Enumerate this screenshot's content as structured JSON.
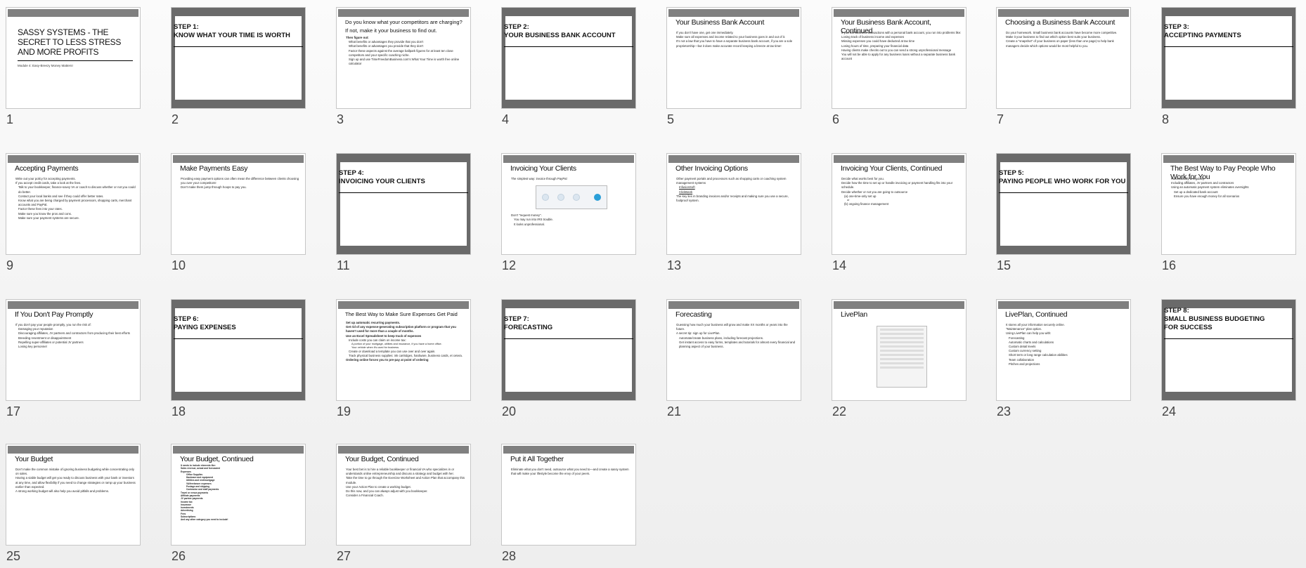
{
  "slides": [
    {
      "n": "1",
      "type": "title",
      "title": "SASSY SYSTEMS - THE SECRET TO LESS STRESS AND MORE PROFITS",
      "subtitle": "Module 4: Easy-Breezy Money Matters!"
    },
    {
      "n": "2",
      "type": "section",
      "title": "STEP 1:\nKNOW WHAT YOUR TIME IS WORTH"
    },
    {
      "n": "3",
      "type": "content",
      "title": "Do you know what your competitors are charging? If not, make it your business to find out.",
      "small": true,
      "lines": [
        {
          "t": "Then figure out:",
          "l": 0
        },
        {
          "t": "What benefits or advantages they provide that you don't",
          "l": 1
        },
        {
          "t": "What benefits or advantages you provide that they don't",
          "l": 1
        },
        {
          "t": "Factor these aspects against the average ballpark figures for at least ten close competitors and your specific coaching niche.",
          "l": 1
        },
        {
          "t": "Sign up and use TimeFreedomBusiness.com's What Your Time is worth free online calculator",
          "l": 1
        }
      ]
    },
    {
      "n": "4",
      "type": "section",
      "title": "STEP 2:\nYOUR BUSINESS BANK ACCOUNT"
    },
    {
      "n": "5",
      "type": "content",
      "title": "Your Business Bank Account",
      "lines": [
        {
          "t": "If you don't have one, get one immediately.",
          "l": 0
        },
        {
          "t": "Make sure all expenses and income related to your business goes in and out of it.",
          "l": 0
        },
        {
          "t": "It's not a law that you have to have a separate business bank account, if you are a sole proprietorship—but it does make accurate record keeping a breeze at tax time!",
          "l": 0
        }
      ]
    },
    {
      "n": "6",
      "type": "content",
      "title": "Your Business Bank Account, Continued",
      "lines": [
        {
          "t": "If you mix business transactions with a personal bank account, you run into problems like:",
          "l": 0
        },
        {
          "t": "Losing track of business income and expenses",
          "l": 0
        },
        {
          "t": "Missing expenses you could have deducted at tax time",
          "l": 0
        },
        {
          "t": "Losing hours of time, preparing your financial data",
          "l": 0
        },
        {
          "t": "Having clients make checks out to you can send a strong unprofessional message",
          "l": 0
        },
        {
          "t": "You will not be able to apply for any business loans without a separate business bank account",
          "l": 0
        }
      ]
    },
    {
      "n": "7",
      "type": "content",
      "title": "Choosing a Business Bank Account",
      "lines": [
        {
          "t": "Do your homework. Small business bank accounts have become more competitive.",
          "l": 0
        },
        {
          "t": "Make it your business to find out which option best suits your business.",
          "l": 0
        },
        {
          "t": "Create a \"snapshot\" of your business on paper (less than one page) to help bank managers decide which options would be most helpful to you.",
          "l": 0
        }
      ]
    },
    {
      "n": "8",
      "type": "section",
      "title": "STEP 3:\nACCEPTING PAYMENTS"
    },
    {
      "n": "9",
      "type": "content",
      "title": "Accepting Payments",
      "lines": [
        {
          "t": "Write out your policy for accepting payments.",
          "l": 0
        },
        {
          "t": "If you accept credit cards, take a look at the fees.",
          "l": 0
        },
        {
          "t": "Talk to your bookkeeper, finance-savvy VA or coach to discuss whether or not you could do better.",
          "l": 1
        },
        {
          "t": "Contact your local banks and see if they could offer better rates.",
          "l": 1
        },
        {
          "t": "Know what you are being charged by payment processors, shopping carts, merchant accounts and PayPal.",
          "l": 1
        },
        {
          "t": "Factor these fees into your rates.",
          "l": 1
        },
        {
          "t": "Make sure you know the pros and cons.",
          "l": 1
        },
        {
          "t": "Make sure your payment systems are secure.",
          "l": 1
        }
      ]
    },
    {
      "n": "10",
      "type": "content",
      "title": "Make Payments Easy",
      "lines": [
        {
          "t": "Providing easy payment options can often mean the difference between clients choosing you over your competitors!",
          "l": 0,
          "nb": true
        },
        {
          "t": " ",
          "l": 0,
          "nb": true
        },
        {
          "t": "Don't make them jump through hoops to pay you.",
          "l": 0,
          "nb": true
        }
      ]
    },
    {
      "n": "11",
      "type": "section",
      "title": "STEP 4:\nINVOICING YOUR CLIENTS"
    },
    {
      "n": "12",
      "type": "content",
      "title": "Invoicing Your Clients",
      "image": "paypal-screenshot",
      "lines": [
        {
          "t": "The simplest way: invoice through PayPal",
          "l": 0
        },
        {
          "img": true
        },
        {
          "t": "Don't \"request money\".",
          "l": 0
        },
        {
          "t": "You may run into IRS trouble.",
          "l": 1
        },
        {
          "t": "It looks unprofessional.",
          "l": 1
        }
      ]
    },
    {
      "n": "13",
      "type": "content",
      "title": "Other Invoicing Options",
      "lines": [
        {
          "t": "Other payment portals and processors such as shopping carts or coaching system management systems",
          "l": 0
        },
        {
          "t": "InfusionSoft",
          "l": 1,
          "u": true
        },
        {
          "t": "ClickBank",
          "l": 1,
          "u": true
        },
        {
          "t": " ",
          "l": 0,
          "nb": true
        },
        {
          "t": "The key lies in branding invoices and/or receipts and making sure you use a secure, foolproof system.",
          "l": 0
        }
      ]
    },
    {
      "n": "14",
      "type": "content",
      "title": "Invoicing Your Clients, Continued",
      "lines": [
        {
          "t": "Decide what works best for you.",
          "l": 0
        },
        {
          "t": "Decide how the time to set up or handle invoicing or payment handling fits into your schedule.",
          "l": 0
        },
        {
          "t": "Decide whether or not you are going to outsource",
          "l": 0
        },
        {
          "t": "(a) one-time-only set up",
          "l": 1
        },
        {
          "t": "or",
          "l": 2,
          "nb": true
        },
        {
          "t": "(b) ongoing finance management",
          "l": 1
        }
      ]
    },
    {
      "n": "15",
      "type": "section",
      "title": "STEP 5:\nPAYING PEOPLE WHO WORK FOR YOU"
    },
    {
      "n": "16",
      "type": "content",
      "title": "The Best Way to Pay People Who Work for You",
      "lines": [
        {
          "t": "Automatically & regularly",
          "l": 0
        },
        {
          "t": "Including affiliates, JV partners and contractors",
          "l": 0
        },
        {
          "t": "Using an automatic payment system eliminates oversights",
          "l": 0
        },
        {
          "t": "Set up a dedicated bank account",
          "l": 1
        },
        {
          "t": "Ensure you have enough money for all scenarios",
          "l": 1
        }
      ]
    },
    {
      "n": "17",
      "type": "content",
      "title": "If You Don't Pay Promptly",
      "lines": [
        {
          "t": "If you don't pay your people promptly, you run the risk of:",
          "l": 0
        },
        {
          "t": "Damaging your reputation",
          "l": 1
        },
        {
          "t": "Discouraging affiliates, JV partners and contractors from producing their best efforts",
          "l": 1
        },
        {
          "t": "Breeding resentment or disappointment",
          "l": 1
        },
        {
          "t": "Repelling super-affiliates or potential JV partners",
          "l": 1
        },
        {
          "t": "Losing key personnel",
          "l": 1
        }
      ]
    },
    {
      "n": "18",
      "type": "section",
      "title": "STEP 6:\nPAYING EXPENSES"
    },
    {
      "n": "19",
      "type": "content",
      "title": "The Best Way to Make Sure Expenses Get Paid",
      "small": true,
      "lines": [
        {
          "t": "Set up automatic recurring payments.",
          "l": 0
        },
        {
          "t": "Get rid of any expense-generating subscription platform or program that you haven't used for more than a couple of months.",
          "l": 0
        },
        {
          "t": "Use an Excel Spreadsheet to keep track of expenses",
          "l": 0
        },
        {
          "t": "Include costs you can claim on income tax:",
          "l": 1
        },
        {
          "t": "A portion of your mortgage, utilities and insurance, if you have a home office.",
          "l": 2
        },
        {
          "t": "Your vehicle when it's used for business.",
          "l": 2
        },
        {
          "t": "Create or download a template you can use over and over again.",
          "l": 1
        },
        {
          "t": "Track physical business supplies: ink cartridges, hardware, business cards, et cetera.",
          "l": 1
        },
        {
          "t": "Ordering online forces you to pre-pay at point of ordering",
          "l": 0
        }
      ]
    },
    {
      "n": "20",
      "type": "section",
      "title": "STEP 7:\nFORECASTING"
    },
    {
      "n": "21",
      "type": "content",
      "title": "Forecasting",
      "lines": [
        {
          "t": "Guessing how much your business will grow and make XX months or years into the future.",
          "l": 0
        },
        {
          "t": "A secret tip: sign up for LivePlan.",
          "l": 0
        },
        {
          "t": "Automate/create business plans, including forecast projections.",
          "l": 1
        },
        {
          "t": "Get instant access to easy forms, templates and tutorials for almost every financial and planning aspect of your business.",
          "l": 1
        }
      ]
    },
    {
      "n": "22",
      "type": "content",
      "title": "LivePlan",
      "image": "liveplan-screenshot",
      "lines": [
        {
          "img2": true
        }
      ]
    },
    {
      "n": "23",
      "type": "content",
      "title": "LivePlan, Continued",
      "lines": [
        {
          "t": "It stores all your information securely online.",
          "l": 0
        },
        {
          "t": "\"Maintenance\" plan option.",
          "l": 0
        },
        {
          "t": "Using LivePlan can help you with:",
          "l": 0
        },
        {
          "t": "Forecasting",
          "l": 1
        },
        {
          "t": "Automatic charts and calculations",
          "l": 1
        },
        {
          "t": "Custom detail levels",
          "l": 1
        },
        {
          "t": "Custom currency setting",
          "l": 1
        },
        {
          "t": "Short term or long range calculation abilities",
          "l": 1
        },
        {
          "t": "Team collaboration",
          "l": 1
        },
        {
          "t": "Pitches and projections",
          "l": 1
        }
      ]
    },
    {
      "n": "24",
      "type": "section",
      "three": true,
      "title": "STEP 8:\nSMALL BUSINESS BUDGETING\nFOR SUCCESS"
    },
    {
      "n": "25",
      "type": "content",
      "title": "Your Budget",
      "lines": [
        {
          "t": "Don't make the common mistake of ignoring business budgeting while concentrating only on sales.",
          "l": 0
        },
        {
          "t": "Having a viable budget will get you ready to discuss business with your bank or investors at any time, and allow flexibility if you need to change strategies or ramp up your business earlier than expected.",
          "l": 0
        },
        {
          "t": "A strong working budget will also help you avoid pitfalls and problems.",
          "l": 0
        }
      ]
    },
    {
      "n": "26",
      "type": "content",
      "title": "Your Budget, Continued",
      "tiny": true,
      "lines": [
        {
          "t": "It needs to include elements like:",
          "l": 0,
          "nb": true
        },
        {
          "t": "Sales revenue, actual and forecasted",
          "l": 0
        },
        {
          "t": "Expenses",
          "l": 0
        },
        {
          "t": "Office Supplies",
          "l": 2
        },
        {
          "t": "Hardware and equipment",
          "l": 2
        },
        {
          "t": "Utilities and rent/mortgage",
          "l": 2
        },
        {
          "t": "VA/freelancer expenses",
          "l": 2
        },
        {
          "t": "Postage and shipping",
          "l": 2
        },
        {
          "t": "Contractor and staff payments",
          "l": 2
        },
        {
          "t": "Travel or venue payments",
          "l": 0
        },
        {
          "t": "Affiliate payments",
          "l": 0
        },
        {
          "t": "JV partner payments",
          "l": 0
        },
        {
          "t": "Income tax",
          "l": 0
        },
        {
          "t": "Insurance",
          "l": 0
        },
        {
          "t": "Investments",
          "l": 0
        },
        {
          "t": "Advertising",
          "l": 0
        },
        {
          "t": "Fees",
          "l": 0
        },
        {
          "t": "Subscriptions",
          "l": 0
        },
        {
          "t": "And any other category you need to include!",
          "l": 0
        }
      ]
    },
    {
      "n": "27",
      "type": "content",
      "title": "Your Budget, Continued",
      "lines": [
        {
          "t": "Your best bet is to hire a reliable bookkeeper or financial VA who specializes in or understands online entrepreneurship and discuss a strategy and budget with her.",
          "l": 0
        },
        {
          "t": "Take the time to go through the Exercise Worksheet and Action Plan that accompany this module.",
          "l": 0
        },
        {
          "t": "Use your Action Plan to create a working budget.",
          "l": 0
        },
        {
          "t": "Do this now, and you can always adjust with you bookkeeper.",
          "l": 0
        },
        {
          "t": "Consider a Financial Coach.",
          "l": 0
        }
      ]
    },
    {
      "n": "28",
      "type": "content",
      "title": "Put it All Together",
      "lines": [
        {
          "t": "Eliminate what you don't need, outsource what you need to—and create a sassy system that will make your lifestyle become the envy of your peers.",
          "l": 0,
          "nb": true
        }
      ]
    }
  ]
}
